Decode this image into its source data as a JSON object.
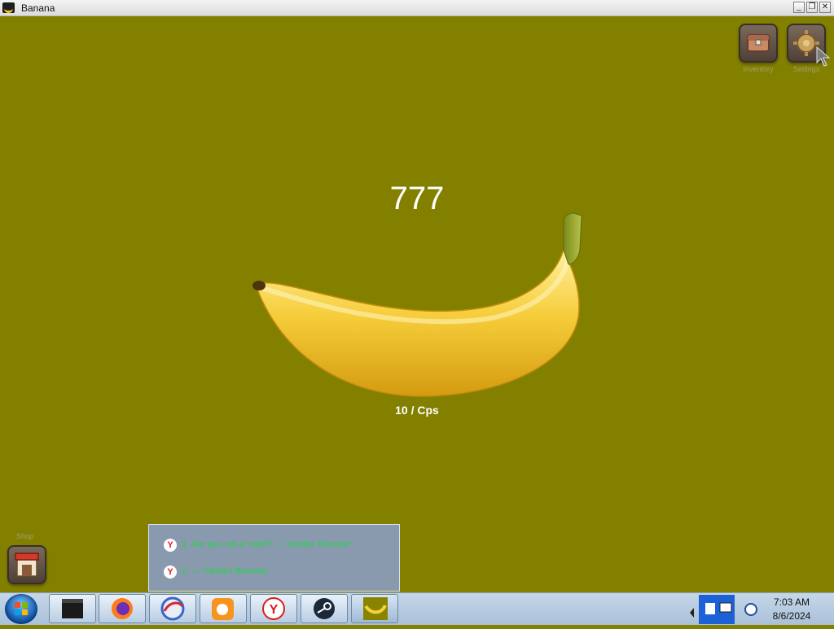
{
  "window": {
    "title": "Banana",
    "controls": [
      "_",
      "❐",
      "✕"
    ]
  },
  "game": {
    "count": "777",
    "cps": "10 / Cps",
    "top_buttons": [
      {
        "label": "Inventory",
        "icon": "chest-icon"
      },
      {
        "label": "Settings",
        "icon": "gear-icon"
      }
    ],
    "shop_label": "Shop"
  },
  "popup": {
    "items": [
      {
        "text": "1. Are you not a robot? — Yandex Browser"
      },
      {
        "text": "2. — Yandex Browser"
      }
    ]
  },
  "taskbar": {
    "apps": [
      "terminal",
      "firefox",
      "browser",
      "uc-browser",
      "yandex",
      "steam",
      "banana"
    ],
    "time": "7:03 AM",
    "date": "8/6/2024"
  },
  "colors": {
    "game_bg": "#838000",
    "count_text": "#ffffff",
    "popup_link": "#22d44a"
  }
}
